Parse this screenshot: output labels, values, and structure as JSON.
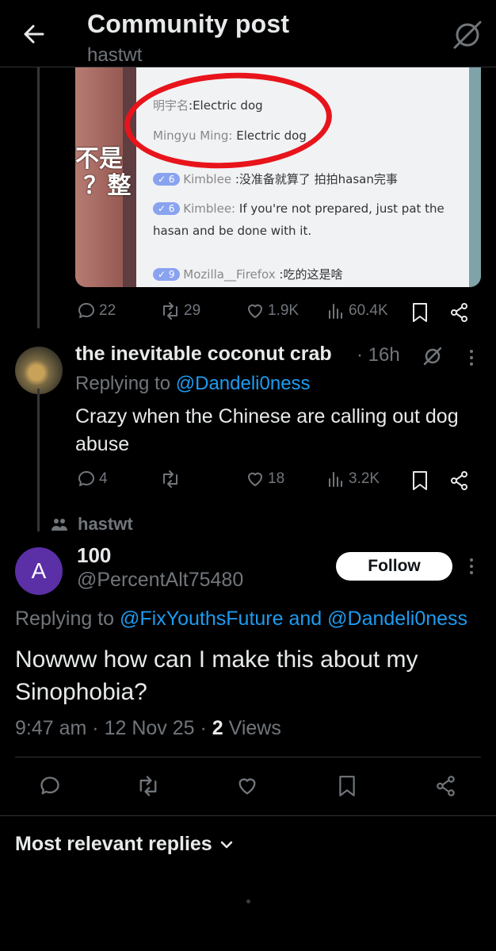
{
  "header": {
    "title": "Community post",
    "subtitle": "hastwt"
  },
  "embedded_screenshot": {
    "side_text": "不是\n？整",
    "lines": [
      {
        "name": "明宇名",
        "text": ":Electric dog"
      },
      {
        "name": "Mingyu Ming:",
        "text": "Electric dog"
      },
      {
        "badge": "6",
        "name": "Kimblee",
        "text": ":没准备就算了 拍拍hasan完事"
      },
      {
        "badge": "6",
        "name": "Kimblee:",
        "text": "If you're not prepared, just pat the"
      },
      {
        "text": "hasan and be done with it."
      },
      {
        "badge": "9",
        "name": "Mozilla__Firefox",
        "text": ":吃的这是啥"
      }
    ]
  },
  "parent_actions": {
    "replies": "22",
    "reposts": "29",
    "likes": "1.9K",
    "views": "60.4K"
  },
  "reply": {
    "name": "the inevitable coconut crab",
    "time": "· 16h",
    "replying_prefix": "Replying to",
    "replying_to": "@Dandeli0ness",
    "text": "Crazy when the Chinese are calling out dog abuse",
    "replies": "4",
    "reposts": "",
    "likes": "18",
    "views": "3.2K"
  },
  "post": {
    "community": "hastwt",
    "avatar_letter": "A",
    "name": "100",
    "handle": "@PercentAlt75480",
    "follow_label": "Follow",
    "replying_prefix": "Replying to",
    "replying_to_1": "@FixYouthsFuture",
    "replying_and": "and",
    "replying_to_2": "@Dandeli0ness",
    "text": "Nowww how can I make this about my Sinophobia?",
    "time": "9:47 am",
    "date": "12 Nov 25",
    "views_count": "2",
    "views_label": "Views"
  },
  "sort": {
    "label": "Most relevant replies"
  },
  "colors": {
    "background": "#000000",
    "text": "#e7e9ea",
    "muted": "#71767b",
    "link": "#1d9bf0",
    "avatar": "#5b2fa6",
    "annotation_red": "#e8141b"
  }
}
